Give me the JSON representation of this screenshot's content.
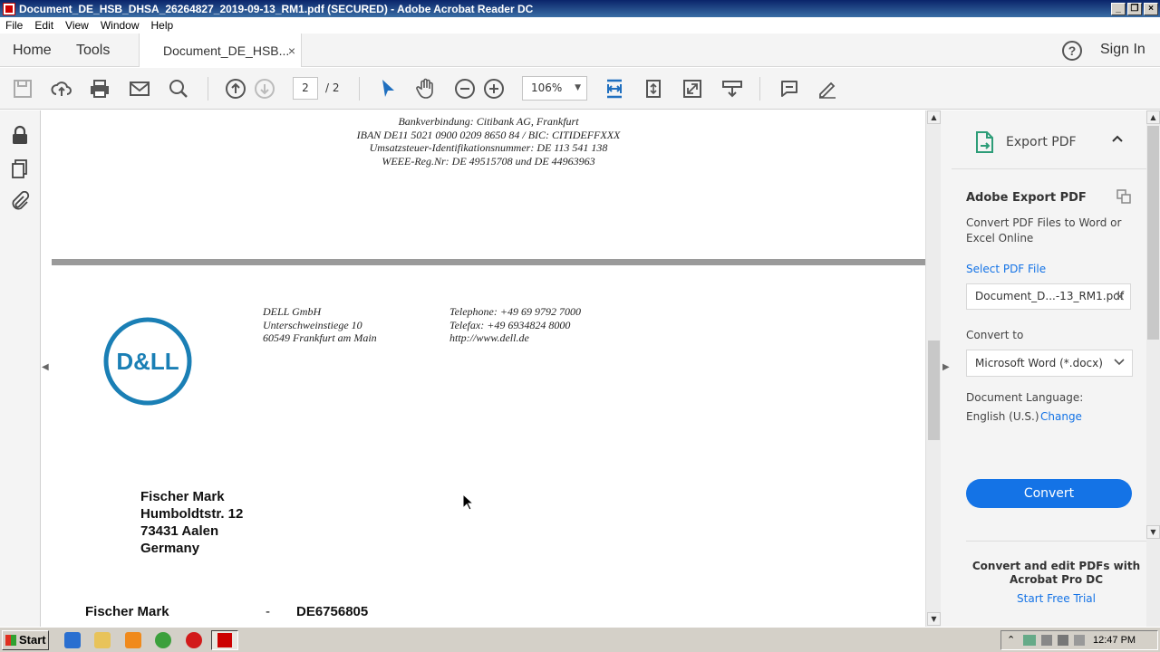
{
  "window": {
    "title": "Document_DE_HSB_DHSA_26264827_2019-09-13_RM1.pdf (SECURED) - Adobe Acrobat Reader DC",
    "buttons": [
      "_",
      "❐",
      "×"
    ]
  },
  "menubar": [
    "File",
    "Edit",
    "View",
    "Window",
    "Help"
  ],
  "tabs": {
    "home": "Home",
    "tools": "Tools",
    "document": "Document_DE_HSB...",
    "close": "×",
    "sign_in": "Sign In",
    "help": "?"
  },
  "toolbar": {
    "page_current": "2",
    "page_total": "/ 2",
    "zoom": "106%",
    "zoom_arrow": "▼",
    "icons": [
      "save-icon",
      "upload-icon",
      "print-icon",
      "email-icon",
      "search-icon",
      "page-up-icon",
      "page-down-icon",
      "select-cursor-icon",
      "hand-icon",
      "zoom-out-icon",
      "zoom-in-icon",
      "fit-width-icon",
      "rotate-icon",
      "fullscreen-icon",
      "scroll-mode-icon",
      "comment-icon",
      "sign-icon"
    ]
  },
  "document": {
    "footer": [
      "Bankverbindung: Citibank AG, Frankfurt",
      "IBAN DE11 5021 0900 0209 8650 84  /  BIC: CITIDEFFXXX",
      "Umsatzsteuer-Identifikationsnummer: DE 113 541 138",
      "WEEE-Reg.Nr: DE 49515708 und DE 44963963"
    ],
    "company": [
      "DELL GmbH",
      "Unterschweinstiege 10",
      "60549 Frankfurt am Main"
    ],
    "contact": [
      "Telephone: +49 69 9792 7000",
      "Telefax: +49 6934824 8000",
      "http://www.dell.de"
    ],
    "logo_text": "D&LL",
    "recipient": [
      "Fischer Mark",
      "Humboldtstr. 12",
      "73431 Aalen",
      "Germany"
    ],
    "ref_name": "Fischer Mark",
    "ref_dash": "-",
    "ref_number": "DE6756805"
  },
  "right_panel": {
    "header": "Export PDF",
    "card_title": "Adobe Export PDF",
    "description": "Convert PDF Files to Word or Excel Online",
    "select_file_label": "Select PDF File",
    "file_value": "Document_D...-13_RM1.pdf",
    "file_clear": "×",
    "convert_to_label": "Convert to",
    "convert_to_value": "Microsoft Word (*.docx)",
    "language_label": "Document Language:",
    "language_value": "English (U.S.)",
    "language_change": "Change",
    "convert_button": "Convert",
    "promo_text": "Convert and edit PDFs with Acrobat Pro DC",
    "promo_link": "Start Free Trial"
  },
  "taskbar": {
    "start": "Start",
    "clock": "12:47 PM"
  },
  "colors": {
    "accent": "#1473e6",
    "dell_blue": "#1a7fb5",
    "tool_blue": "#1f6fbf"
  }
}
